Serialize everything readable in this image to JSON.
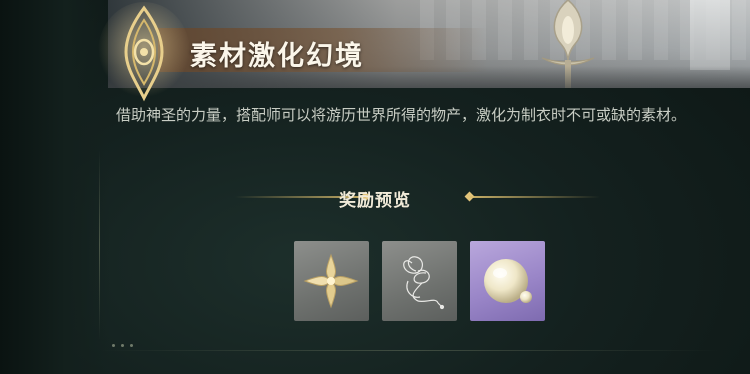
{
  "header": {
    "title": "素材激化幻境",
    "emblem_icon": "eye-crest-icon"
  },
  "description": {
    "text": "借助神圣的力量，搭配师可以将游历世界所得的物产，激化为制衣时不可或缺的素材。"
  },
  "rewards": {
    "title": "奖励预览",
    "items": [
      {
        "icon": "gold-star-flower-icon",
        "rarity": "common",
        "bg_color": "#7b7e7b"
      },
      {
        "icon": "silver-thread-icon",
        "rarity": "common",
        "bg_color": "#7b7e7b"
      },
      {
        "icon": "pearl-icon",
        "rarity": "rare",
        "bg_color": "#a592d0"
      }
    ]
  },
  "colors": {
    "accent_gold": "#e2c47a",
    "background": "#14211f",
    "text_primary": "#fbf6ea",
    "text_secondary": "#c8cdc4"
  }
}
